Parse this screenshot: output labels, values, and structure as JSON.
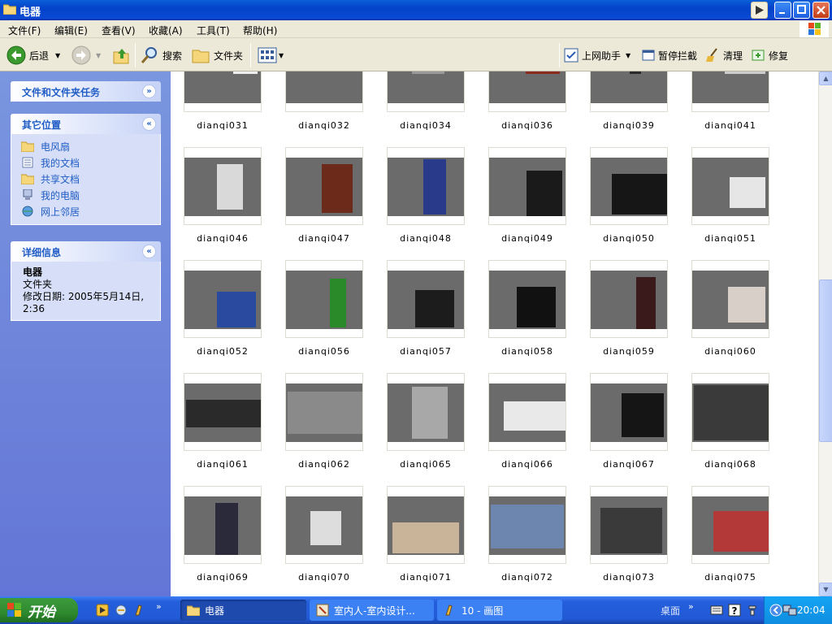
{
  "window": {
    "title": "电器"
  },
  "menu": [
    "文件(F)",
    "编辑(E)",
    "查看(V)",
    "收藏(A)",
    "工具(T)",
    "帮助(H)"
  ],
  "toolbar": {
    "back": "后退",
    "search": "搜索",
    "folders": "文件夹",
    "online_helper": "上网助手",
    "block": "暂停拦截",
    "clean": "清理",
    "repair": "修复"
  },
  "tasks_panel": {
    "title": "文件和文件夹任务"
  },
  "other_places": {
    "title": "其它位置",
    "items": [
      "电风扇",
      "我的文档",
      "共享文档",
      "我的电脑",
      "网上邻居"
    ]
  },
  "details": {
    "title": "详细信息",
    "name": "电器",
    "type": "文件夹",
    "modified_line1": "修改日期: 2005年5月14日,",
    "modified_line2": "2:36"
  },
  "files": [
    "dianqi031",
    "dianqi032",
    "dianqi034",
    "dianqi036",
    "dianqi039",
    "dianqi041",
    "dianqi046",
    "dianqi047",
    "dianqi048",
    "dianqi049",
    "dianqi050",
    "dianqi051",
    "dianqi052",
    "dianqi056",
    "dianqi057",
    "dianqi058",
    "dianqi059",
    "dianqi060",
    "dianqi061",
    "dianqi062",
    "dianqi065",
    "dianqi066",
    "dianqi067",
    "dianqi068",
    "dianqi069",
    "dianqi070",
    "dianqi071",
    "dianqi072",
    "dianqi073",
    "dianqi075"
  ],
  "taskbar": {
    "start": "开始",
    "tasks": [
      "电器",
      "室内人-室内设计...",
      "10 - 画图"
    ],
    "desktop": "桌面",
    "clock": "20:04"
  },
  "colors": {
    "taskbar": "#245edb",
    "leftpane": "#7a96df",
    "link": "#215dc6"
  }
}
